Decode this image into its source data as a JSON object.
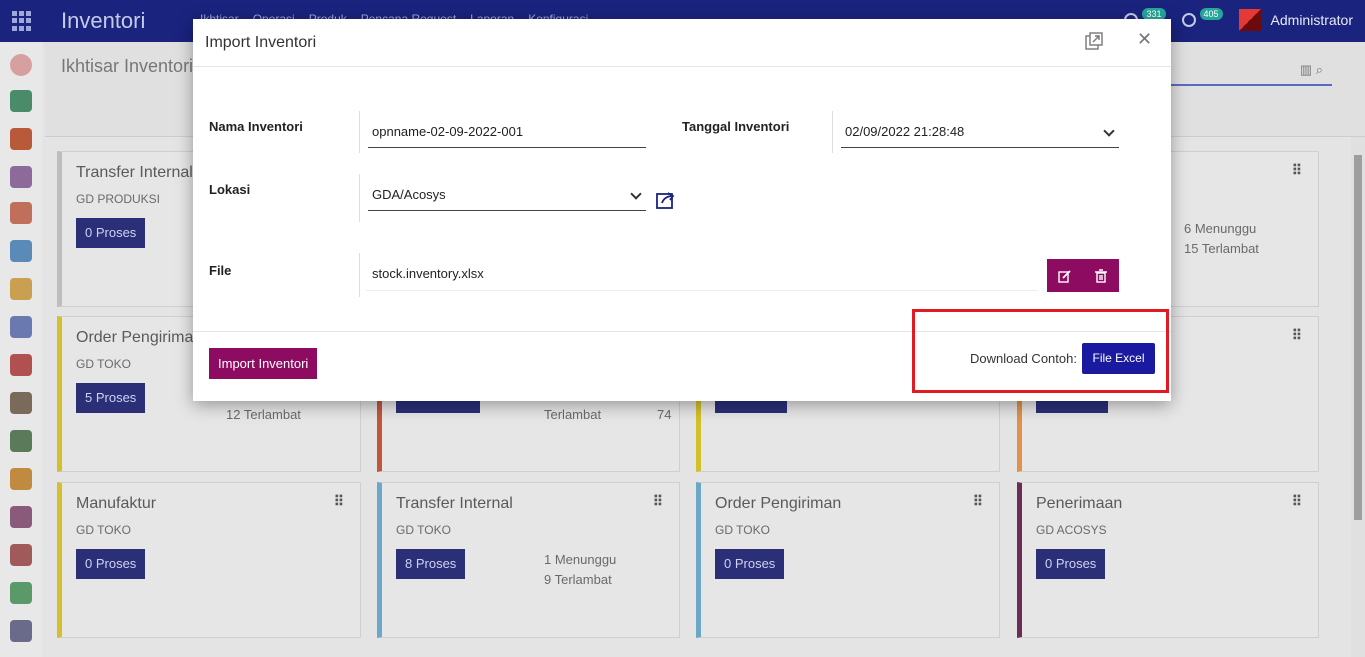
{
  "topbar": {
    "app_title": "Inventori",
    "menu": [
      "Ikhtisar",
      "Operasi",
      "Produk",
      "Pencana Request",
      "Laporan",
      "Konfigurasi"
    ],
    "activity_count": "331",
    "clock_count": "405",
    "user": "Administrator"
  },
  "breadcrumb": {
    "title": "Ikhtisar Inventori"
  },
  "cards": [
    {
      "title": "Transfer Internal",
      "sub": "GD PRODUKSI",
      "btn": "0 Proses",
      "stats": [],
      "accent": "#bdbdbd"
    },
    {
      "title": "",
      "sub": "",
      "btn": "",
      "stats": [
        "6 Menunggu",
        "15 Terlambat"
      ],
      "accent": "#bdbdbd"
    },
    {
      "title": "Order Pengiriman",
      "sub": "GD TOKO",
      "btn": "5 Proses",
      "stats": [
        "12 Terlambat"
      ],
      "accent": "#d4c02a"
    },
    {
      "title": "",
      "sub": "",
      "btn": "",
      "stats": [
        "Terlambat",
        "74"
      ],
      "accent": "#c0573d"
    },
    {
      "title": "Manufaktur",
      "sub": "GD TOKO",
      "btn": "0 Proses",
      "stats": [],
      "accent": "#d4c02a"
    },
    {
      "title": "Transfer Internal",
      "sub": "GD TOKO",
      "btn": "8 Proses",
      "stats": [
        "1 Menunggu",
        "9 Terlambat"
      ],
      "accent": "#6aa7c9"
    },
    {
      "title": "Order Pengiriman",
      "sub": "GD TOKO",
      "btn": "0 Proses",
      "stats": [],
      "accent": "#6aa7c9"
    },
    {
      "title": "Penerimaan",
      "sub": "GD ACOSYS",
      "btn": "0 Proses",
      "stats": [],
      "accent": "#6b2c55"
    }
  ],
  "dialog": {
    "title": "Import Inventori",
    "nama_label": "Nama Inventori",
    "nama_value": "opnname-02-09-2022-001",
    "tanggal_label": "Tanggal Inventori",
    "tanggal_value": "02/09/2022 21:28:48",
    "lokasi_label": "Lokasi",
    "lokasi_value": "GDA/Acosys",
    "file_label": "File",
    "file_value": "stock.inventory.xlsx",
    "import_button": "Import Inventori",
    "download_label": "Download Contoh:",
    "excel_button": "File Excel"
  },
  "colors": {
    "topbar": "#1a237e",
    "primary_button": "#8e0b62",
    "excel_button": "#1a1aa0",
    "highlight": "#e21b23"
  }
}
